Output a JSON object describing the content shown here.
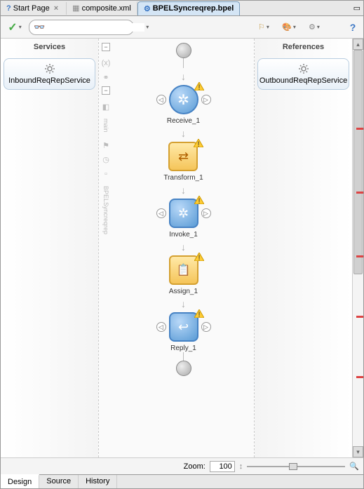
{
  "tabs": {
    "start": "Start Page",
    "composite": "composite.xml",
    "bpel": "BPELSyncreqrep.bpel"
  },
  "sidebar": {
    "services_header": "Services",
    "references_header": "References",
    "inbound_service": "InboundReqRepService",
    "outbound_service": "OutboundReqRepService"
  },
  "flow": {
    "main_label": "main",
    "vertical_label": "BPELSyncreqrep",
    "activities": [
      {
        "label": "Receive_1",
        "color": "blue",
        "shape": "circle",
        "icon": "gear",
        "warn": true
      },
      {
        "label": "Transform_1",
        "color": "yellow",
        "shape": "rect",
        "icon": "transform",
        "warn": true
      },
      {
        "label": "Invoke_1",
        "color": "blue",
        "shape": "rect",
        "icon": "gear",
        "warn": true
      },
      {
        "label": "Assign_1",
        "color": "yellow",
        "shape": "rect",
        "icon": "assign",
        "warn": true
      },
      {
        "label": "Reply_1",
        "color": "blue",
        "shape": "rect",
        "icon": "reply",
        "warn": true
      }
    ]
  },
  "zoom": {
    "label": "Zoom:",
    "value": "100"
  },
  "bottom_tabs": {
    "design": "Design",
    "source": "Source",
    "history": "History"
  },
  "icons": {
    "help": "?",
    "close": "×",
    "check": "✓",
    "binoculars": "🔍",
    "bookmark": "▯",
    "palette": "◐",
    "tools": "⚙",
    "dropdown": "▾",
    "restore": "▭",
    "spinner": "↕",
    "zoom_icon": "🔍",
    "left": "◁",
    "right": "▷",
    "up": "▴",
    "down": "▾",
    "minus": "−",
    "x_var": "(x)"
  }
}
